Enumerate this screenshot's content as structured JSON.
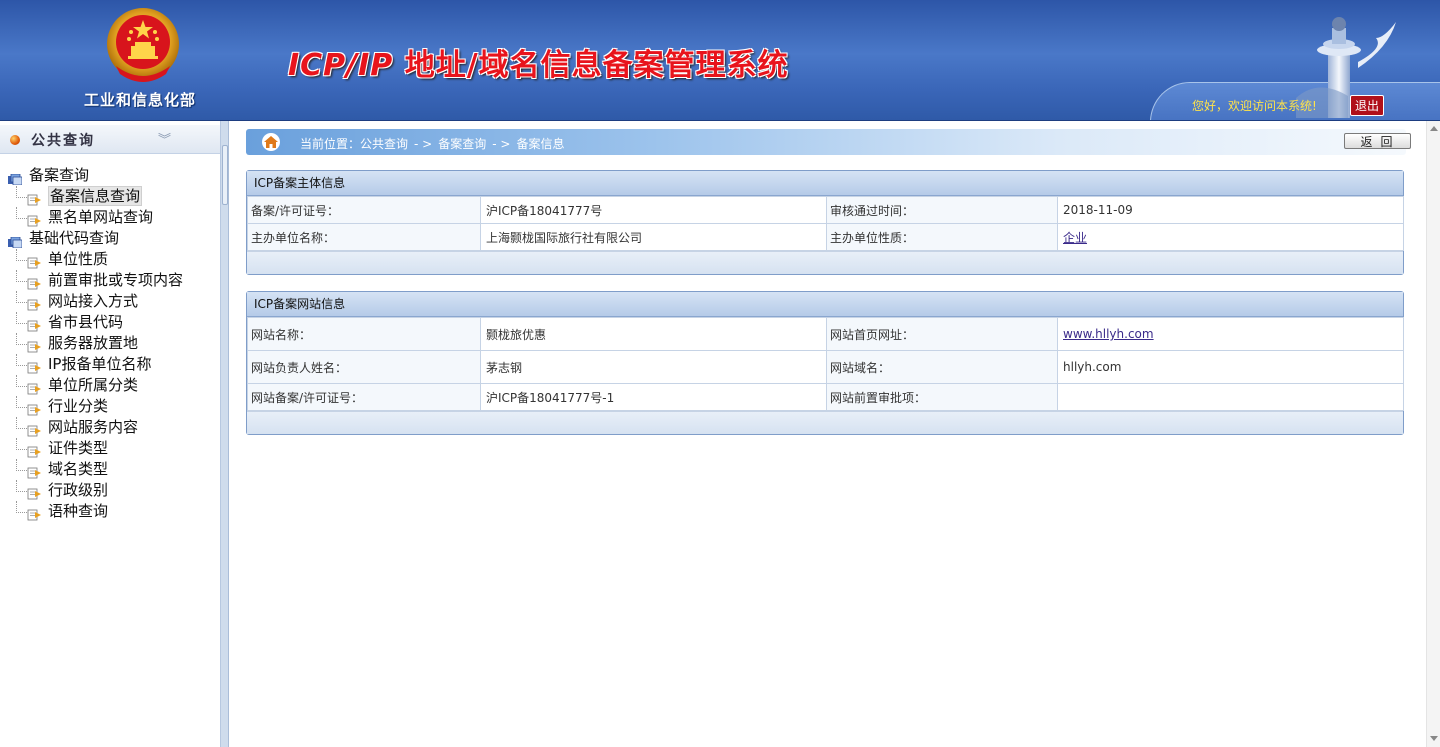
{
  "header": {
    "ministry": "工业和信息化部",
    "title_latin": "ICP/IP",
    "title_cjk": " 地址/域名信息备案管理系统",
    "welcome": "您好，欢迎访问本系统!",
    "logout_label": "退出"
  },
  "sidebar": {
    "title": "公共查询",
    "collapse_glyph": "≫",
    "groups": [
      {
        "label": "备案查询",
        "items": [
          "备案信息查询",
          "黑名单网站查询"
        ]
      },
      {
        "label": "基础代码查询",
        "items": [
          "单位性质",
          "前置审批或专项内容",
          "网站接入方式",
          "省市县代码",
          "服务器放置地",
          "IP报备单位名称",
          "单位所属分类",
          "行业分类",
          "网站服务内容",
          "证件类型",
          "域名类型",
          "行政级别",
          "语种查询"
        ]
      }
    ],
    "selected": "备案信息查询"
  },
  "breadcrumb": {
    "prefix": "当前位置：公共查询",
    "sep": "- >",
    "level2": "备案查询",
    "level3": "备案信息"
  },
  "back_label": "返回",
  "entity_panel": {
    "title": "ICP备案主体信息",
    "rows": [
      {
        "l1": "备案/许可证号：",
        "v1": "沪ICP备18041777号",
        "l2": "审核通过时间：",
        "v2": "2018-11-09"
      },
      {
        "l1": "主办单位名称：",
        "v1": "上海颢栊国际旅行社有限公司",
        "l2": "主办单位性质：",
        "v2": "企业"
      }
    ]
  },
  "site_panel": {
    "title": "ICP备案网站信息",
    "rows": [
      {
        "l1": "网站名称：",
        "v1": "颢栊旅优惠",
        "l2": "网站首页网址：",
        "v2": "www.hllyh.com"
      },
      {
        "l1": "网站负责人姓名：",
        "v1": "茅志钢",
        "l2": "网站域名：",
        "v2": "hllyh.com"
      },
      {
        "l1": "网站备案/许可证号：",
        "v1": "沪ICP备18041777号-1",
        "l2": "网站前置审批项：",
        "v2": ""
      }
    ]
  },
  "colors": {
    "header_blue": "#3a66b8",
    "title_red": "#e8141c",
    "welcome_yellow": "#ffe34a"
  },
  "icons": [
    "national-emblem-icon",
    "pillar-icon",
    "home-icon",
    "folder-icon",
    "document-icon"
  ]
}
